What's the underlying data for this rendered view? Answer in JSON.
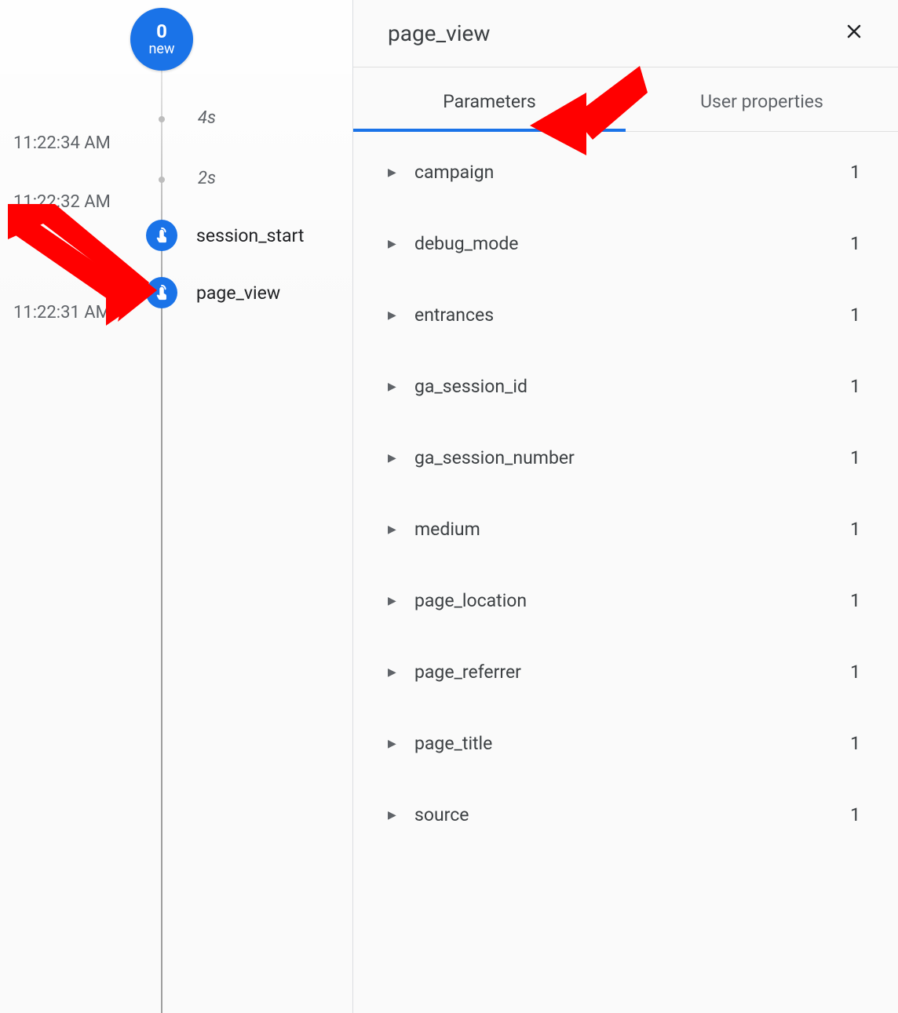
{
  "timeline": {
    "badge_count": "0",
    "badge_label": "new",
    "ticks": [
      {
        "duration": "4s",
        "timestamp": "11:22:34 AM"
      },
      {
        "duration": "2s",
        "timestamp": "11:22:32 AM"
      }
    ],
    "events": [
      {
        "name": "session_start"
      },
      {
        "name": "page_view"
      }
    ],
    "last_timestamp": "11:22:31 AM"
  },
  "details": {
    "title": "page_view",
    "tabs": {
      "parameters": "Parameters",
      "user_properties": "User properties"
    },
    "parameters": [
      {
        "key": "campaign",
        "count": "1"
      },
      {
        "key": "debug_mode",
        "count": "1"
      },
      {
        "key": "entrances",
        "count": "1"
      },
      {
        "key": "ga_session_id",
        "count": "1"
      },
      {
        "key": "ga_session_number",
        "count": "1"
      },
      {
        "key": "medium",
        "count": "1"
      },
      {
        "key": "page_location",
        "count": "1"
      },
      {
        "key": "page_referrer",
        "count": "1"
      },
      {
        "key": "page_title",
        "count": "1"
      },
      {
        "key": "source",
        "count": "1"
      }
    ]
  }
}
